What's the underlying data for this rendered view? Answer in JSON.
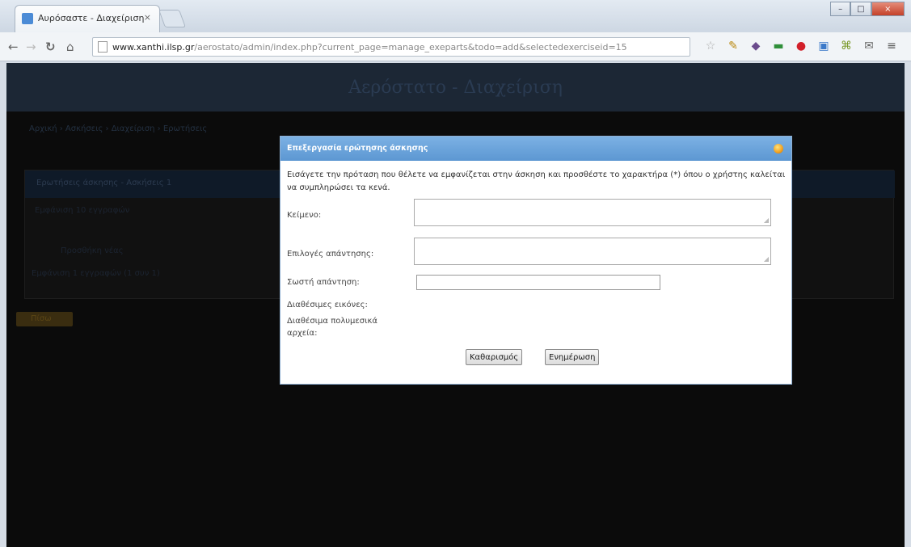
{
  "browser": {
    "tab_title": "Αυρόσαστε - Διαχείριση",
    "tab_close": "×",
    "url_domain": "www.xanthi.ilsp.gr",
    "url_path": "/aerostato/admin/index.php?current_page=manage_exeparts&todo=add&selectedexerciseid=15",
    "win_min": "–",
    "win_max": "□",
    "win_close": "×"
  },
  "site": {
    "title": "Αερόστατο - Διαχείριση",
    "breadcrumb": "Αρχική  › Ασκήσεις  › Διαχείριση  › Ερωτήσεις",
    "panel_header": "Ερωτήσεις άσκησης - Ασκήσεις 1",
    "records_label": "Εμφάνιση  10  εγγραφών",
    "row_text": "Προσθήκη νέας",
    "footer_text": "Εμφάνιση 1 εγγραφών (1 συν 1)",
    "back_label": "Πίσω"
  },
  "dialog": {
    "title": "Επεξεργασία ερώτησης άσκησης",
    "instructions": "Εισάγετε την πρόταση που θέλετε να εμφανίζεται στην άσκηση και προσθέστε το χαρακτήρα (*) όπου ο χρήστης καλείται να συμπληρώσει τα κενά.",
    "text_label": "Κείμενο:",
    "choices_label": "Επιλογές απάντησης:",
    "correct_label": "Σωστή απάντηση:",
    "images_label": "Διαθέσιμες εικόνες:",
    "media_label": "Διαθέσιμα πολυμεσικά αρχεία:",
    "text_value": "",
    "choices_value": "",
    "correct_value": "",
    "clear_button": "Καθαρισμός",
    "update_button": "Ενημέρωση"
  },
  "colors": {
    "dialog_header": "#5c97d2",
    "overlay": "#0b0b0b"
  }
}
